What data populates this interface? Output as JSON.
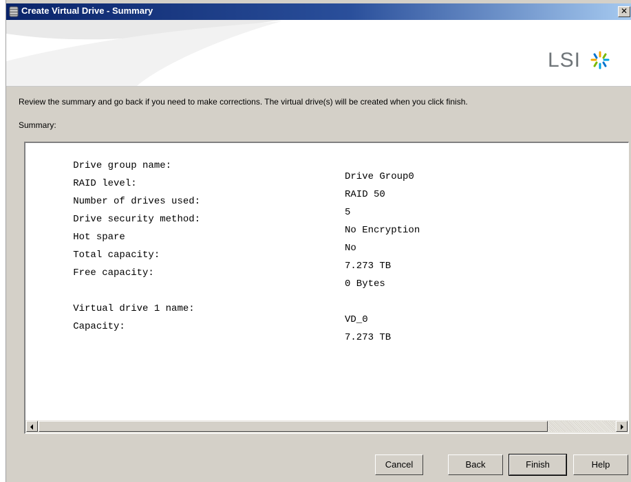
{
  "window": {
    "title": "Create Virtual Drive - Summary",
    "close_glyph": "✕"
  },
  "banner": {
    "logo_text": "LSI"
  },
  "intro_text": "Review the summary and go back if you need to make corrections. The virtual drive(s) will be created when you click finish.",
  "summary_label": "Summary:",
  "summary_rows": [
    {
      "label": "Drive group name:",
      "value": "Drive Group0"
    },
    {
      "label": "RAID level:",
      "value": "RAID 50"
    },
    {
      "label": "Number of drives used:",
      "value": "5"
    },
    {
      "label": "Drive security method:",
      "value": "No Encryption"
    },
    {
      "label": "Hot spare",
      "value": "No"
    },
    {
      "label": "Total capacity:",
      "value": "7.273 TB"
    },
    {
      "label": "Free capacity:",
      "value": "0 Bytes"
    },
    {
      "label": "Virtual drive 1 name:",
      "value": "VD_0"
    },
    {
      "label": "Capacity:",
      "value": "7.273 TB"
    }
  ],
  "buttons": {
    "cancel": "Cancel",
    "back": "Back",
    "finish": "Finish",
    "help": "Help"
  },
  "colors": {
    "titlebar": "#0a246a",
    "dialog_bg": "#d4d0c8",
    "logo_gray": "#6f7579"
  },
  "icons": {
    "app": "database-icon",
    "close": "close-icon",
    "logo": "lsi-starburst-icon"
  }
}
